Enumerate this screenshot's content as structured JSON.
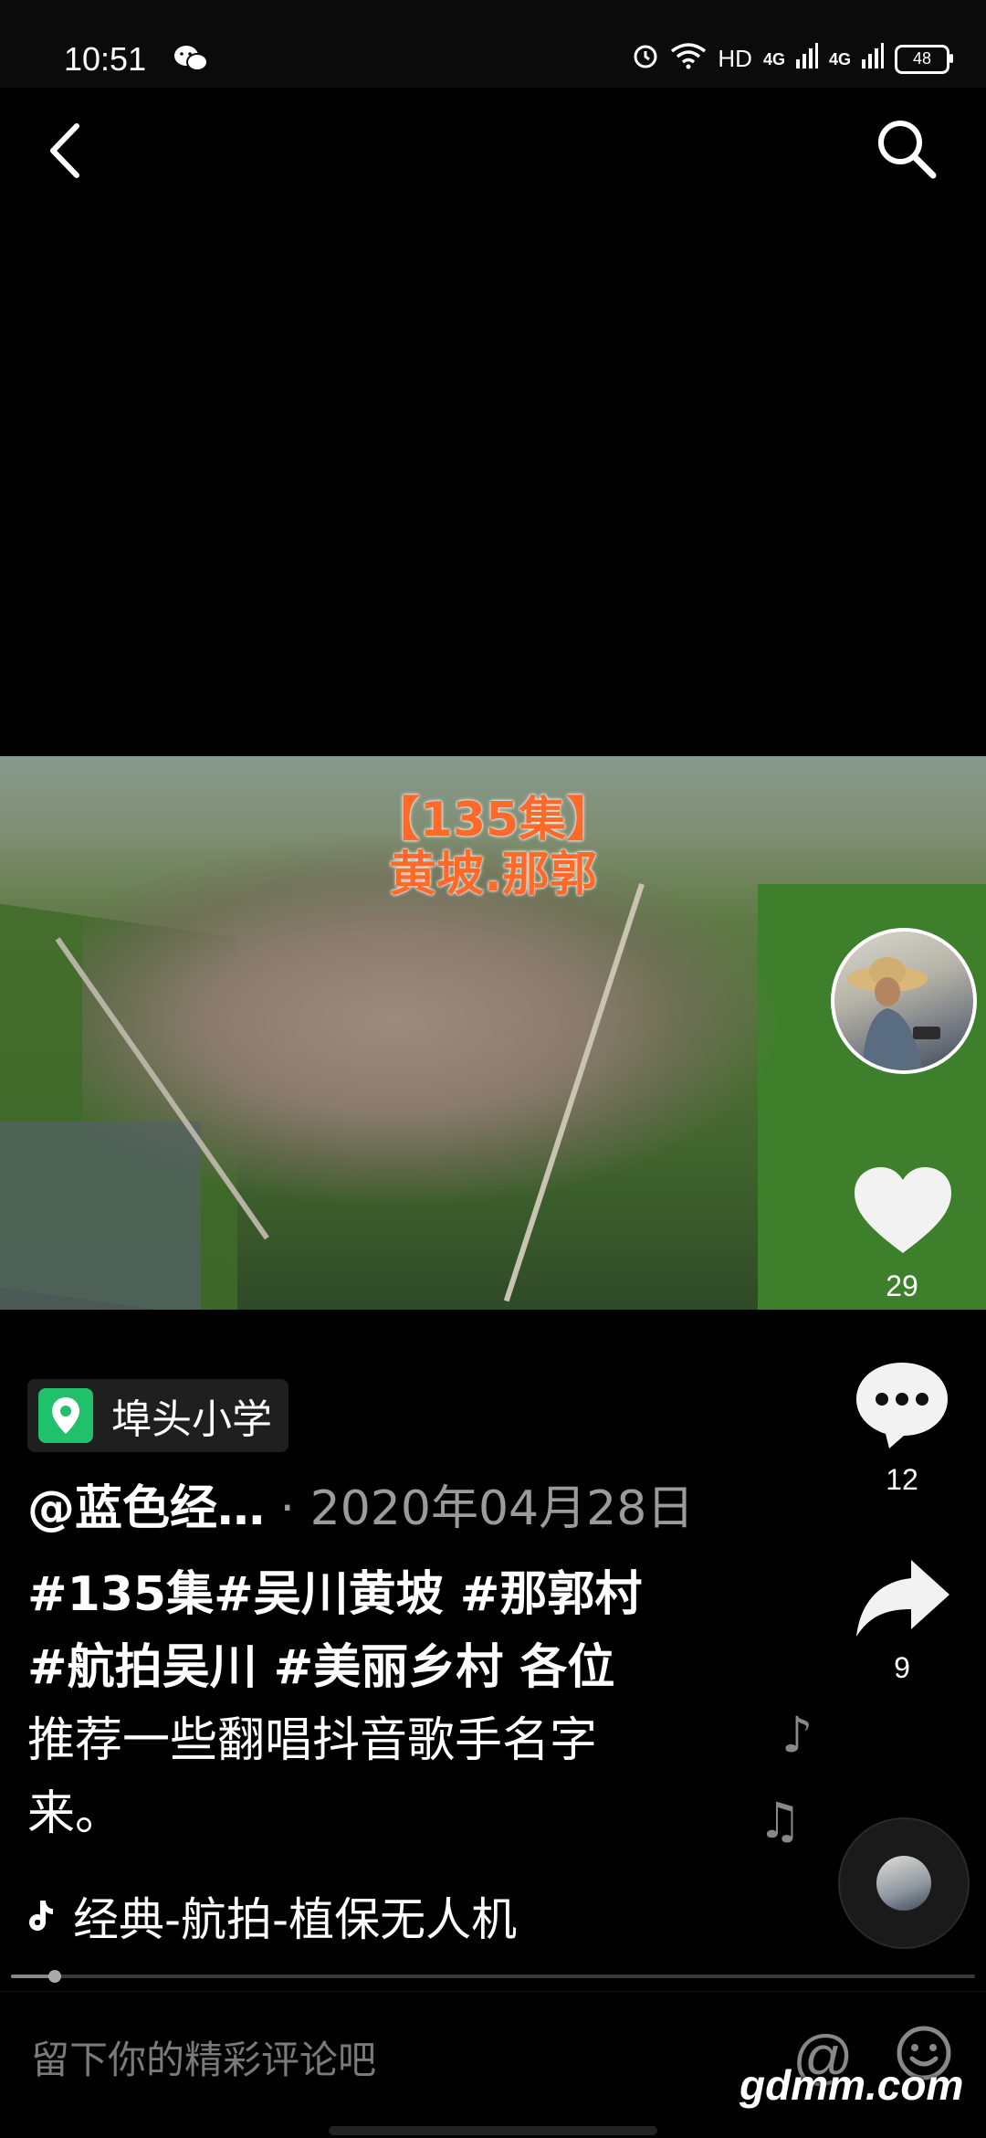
{
  "status_bar": {
    "time": "10:51",
    "network": "HD",
    "signal1": "4G",
    "signal2": "4G",
    "battery": "48"
  },
  "video": {
    "overlay_title_line1": "【135集】",
    "overlay_title_line2": "黄坡.那郭"
  },
  "actions": {
    "like_count": "29",
    "comment_count": "12",
    "share_count": "9"
  },
  "post": {
    "location": "埠头小学",
    "author": "@蓝色经…",
    "date": "· 2020年04月28日",
    "caption_line1": "#135集#吴川黄坡 #那郭村",
    "caption_line2": "#航拍吴川 #美丽乡村  各位",
    "caption_line3": "推荐一些翻唱抖音歌手名字",
    "caption_line4": "来。",
    "song": "经典-航拍-植保无人机"
  },
  "playback": {
    "progress_fraction": 0.045
  },
  "comment_bar": {
    "placeholder": "留下你的精彩评论吧",
    "at_symbol": "@",
    "watermark": "gdmm.com"
  },
  "colors": {
    "background": "#000000",
    "overlay_title": "#ff6a2b",
    "location_pin": "#21c16b"
  }
}
